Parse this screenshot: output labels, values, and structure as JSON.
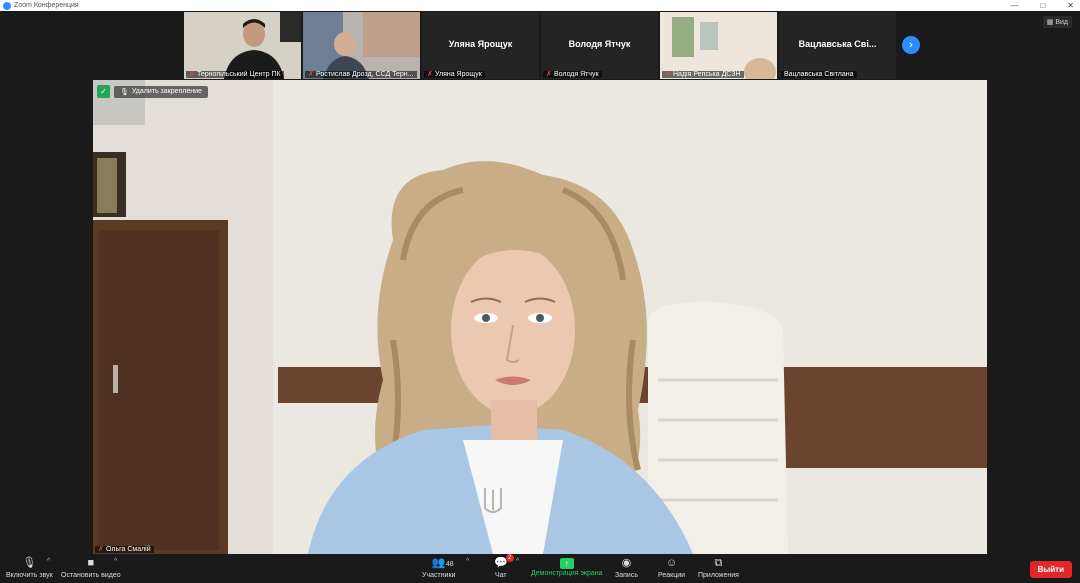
{
  "window": {
    "title": "Zoom Конференция",
    "minimize": "—",
    "maximize": "□",
    "close": "✕"
  },
  "view_button": "Вид",
  "participants_strip": [
    {
      "caption": "Тернопільський Центр ПК",
      "name_center": ""
    },
    {
      "caption": "Ростислав Дрозд, ССД Терн...",
      "name_center": ""
    },
    {
      "caption": "Уляна Ярощук",
      "name_center": "Уляна Ярощук"
    },
    {
      "caption": "Володя Ятчук",
      "name_center": "Володя Ятчук"
    },
    {
      "caption": "Надія Репська ДСЗН",
      "name_center": ""
    },
    {
      "caption": "Вацлавська Світлана",
      "name_center": "Вацлавська Сві..."
    }
  ],
  "main_video": {
    "remove_pin_label": "Удалить закрепление",
    "caption": "Ольга Смалій"
  },
  "toolbar": {
    "audio": "Включить звук",
    "video": "Остановить видео",
    "participants": "Участники",
    "participants_count": "48",
    "chat": "Чат",
    "chat_badge": "2",
    "share": "Демонстрация экрана",
    "record": "Запись",
    "reactions": "Реакции",
    "apps": "Приложения",
    "leave": "Выйти"
  },
  "colors": {
    "accent": "#2d8cff",
    "leave": "#e02828",
    "share": "#23d160",
    "muted": "#e74c3c"
  }
}
